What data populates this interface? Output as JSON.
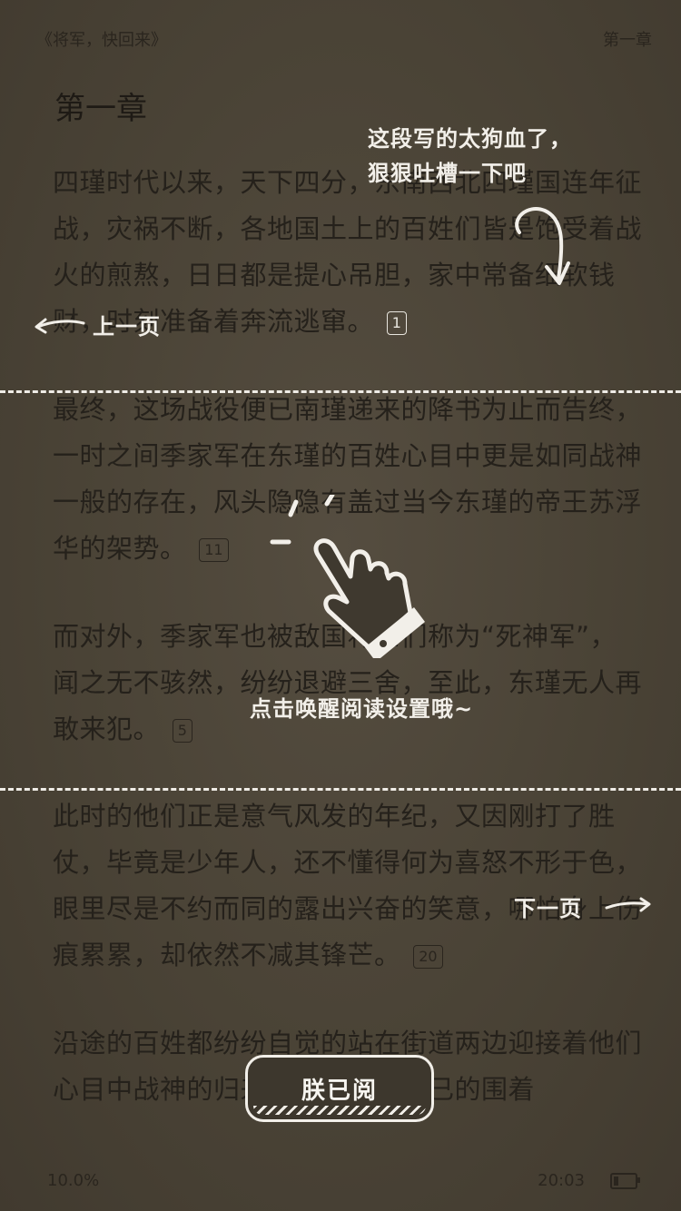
{
  "header": {
    "book_title": "《将军，快回来》",
    "chapter": "第一章"
  },
  "content": {
    "chapter_title": "第一章",
    "paragraphs": [
      {
        "text": "四瑾时代以来，天下四分，东南西北四瑾国连年征战，灾祸不断，各地国土上的百姓们皆是饱受着战火的煎熬，日日都是提心吊胆，家中常备细软钱财，时刻准备着奔流逃窜。",
        "note_count": "1"
      },
      {
        "text": "最终，这场战役便已南瑾递来的降书为止而告终，一时之间季家军在东瑾的百姓心目中更是如同战神一般的存在，风头隐隐有盖过当今东瑾的帝王苏浮华的架势。",
        "note_count": "11"
      },
      {
        "text": "而对外，季家军也被敌国将士们称为“死神军”，闻之无不骇然，纷纷退避三舍，至此，东瑾无人再敢来犯。",
        "note_count": "5"
      },
      {
        "text": "此时的他们正是意气风发的年纪，又因刚打了胜仗，毕竟是少年人，还不懂得何为喜怒不形于色，眼里尽是不约而同的露出兴奋的笑意，哪怕身上伤痕累累，却依然不减其锋芒。",
        "note_count": "20"
      },
      {
        "text": "沿途的百姓都纷纷自觉的站在街道两边迎接着他们心目中战神的归来，皆是激动不已的围着",
        "note_count": ""
      }
    ]
  },
  "guide": {
    "comment_hint_line1": "这段写的太狗血了，",
    "comment_hint_line2": "狠狠吐槽一下吧",
    "prev_page": "上一页",
    "next_page": "下一页",
    "center_hint": "点击唤醒阅读设置哦~",
    "ok_button": "朕已阅"
  },
  "footer": {
    "progress": "10.0%",
    "time": "20:03"
  },
  "colors": {
    "overlay_bg": "#4b4437",
    "guide_text": "#f2efe9",
    "body_text": "#25211b"
  }
}
